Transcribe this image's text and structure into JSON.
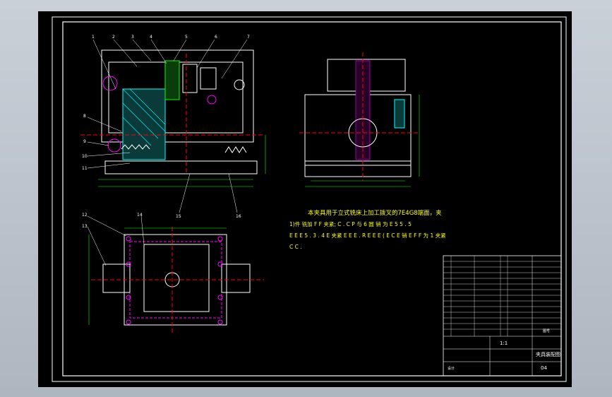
{
  "drawing": {
    "note_line1": "本夹具用于立式铣床上加工拨叉的7E4G8端面，夹",
    "note_line2": "1)件  铣加 F F 夹紧; C . C P 与  6 圆 销 为 E 5 5 . 5",
    "note_line3": "E E E 5 . 3 . 4 E  夹紧 E E E . R E E E ( E C E 销 E  F F 为 1 夹紧",
    "note_line4": "C C .",
    "part_numbers_front": [
      "1",
      "2",
      "3",
      "4",
      "5",
      "6",
      "7",
      "8",
      "9",
      "10",
      "11",
      "15",
      "16"
    ],
    "part_numbers_top": [
      "12",
      "13",
      "14"
    ],
    "title_block": {
      "drawing_name": "夹具装配图",
      "sheet_code": "04",
      "scale_label": "1:1",
      "designer_label": "设计",
      "sheet_mark": "图号"
    }
  },
  "colors": {
    "background": "#000000",
    "frame": "#ffffff",
    "dimension": "#00ff00",
    "center_line": "#ff0000",
    "hatch": "#00ffff",
    "part": "#ffffff",
    "note": "#ffff00",
    "highlight": "#ff00ff"
  }
}
